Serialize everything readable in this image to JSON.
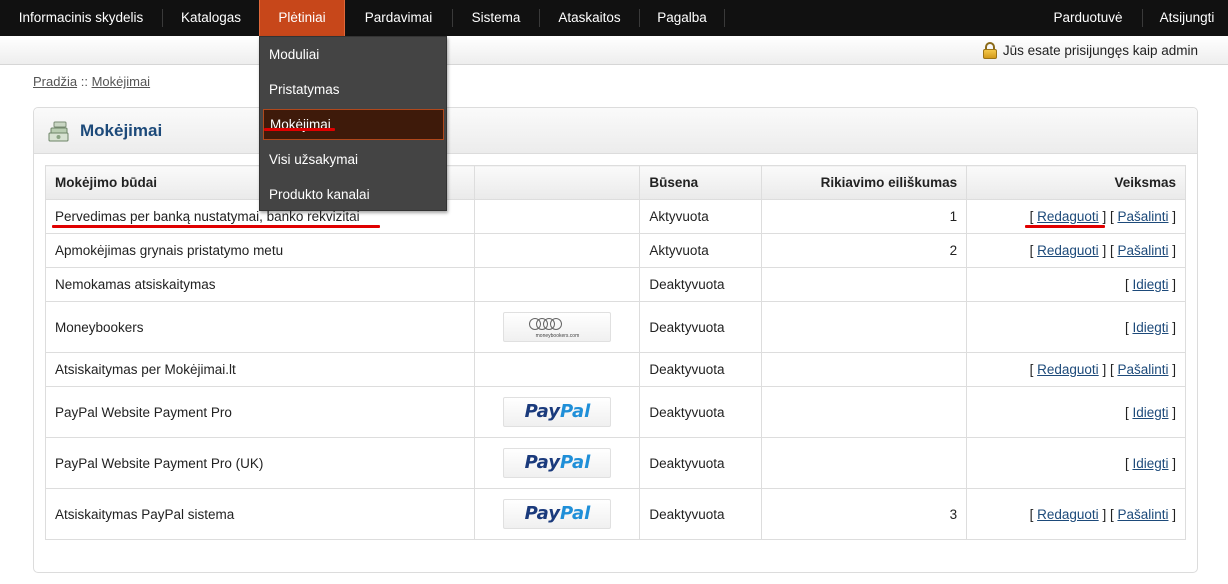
{
  "nav": {
    "items": [
      {
        "label": "Informacinis skydelis"
      },
      {
        "label": "Katalogas"
      },
      {
        "label": "Plėtiniai"
      },
      {
        "label": "Pardavimai"
      },
      {
        "label": "Sistema"
      },
      {
        "label": "Ataskaitos"
      },
      {
        "label": "Pagalba"
      }
    ],
    "right": [
      {
        "label": "Parduotuvė"
      },
      {
        "label": "Atsijungti"
      }
    ]
  },
  "subbar": {
    "login_text": "Jūs esate prisijungęs kaip admin",
    "icon": "lock-icon"
  },
  "dropdown": {
    "items": [
      {
        "label": "Moduliai"
      },
      {
        "label": "Pristatymas"
      },
      {
        "label": "Mokėjimai"
      },
      {
        "label": "Visi užsakymai"
      },
      {
        "label": "Produkto kanalai"
      }
    ]
  },
  "breadcrumb": {
    "home": "Pradžia",
    "separator": "::",
    "current": "Mokėjimai"
  },
  "panel": {
    "title": "Mokėjimai",
    "icon": "money-icon"
  },
  "table": {
    "headers": {
      "method": "Mokėjimo būdai",
      "logo": "",
      "status": "Būsena",
      "order": "Rikiavimo eiliškumas",
      "action": "Veiksmas"
    },
    "rows": [
      {
        "name": "Pervedimas per banką nustatymai, banko rekvizitai",
        "status": "Aktyvuota",
        "order": "1",
        "edit": "Redaguoti",
        "remove": "Pašalinti"
      },
      {
        "name": "Apmokėjimas grynais pristatymo metu",
        "status": "Aktyvuota",
        "order": "2",
        "edit": "Redaguoti",
        "remove": "Pašalinti"
      },
      {
        "name": "Nemokamas atsiskaitymas",
        "status": "Deaktyvuota",
        "order": "",
        "install": "Idiegti"
      },
      {
        "name": "Moneybookers",
        "status": "Deaktyvuota",
        "order": "",
        "install": "Idiegti",
        "logo": "moneybookers-logo",
        "logo_text": "moneybookers.com"
      },
      {
        "name": "Atsiskaitymas per Mokėjimai.lt",
        "status": "Deaktyvuota",
        "order": "",
        "edit": "Redaguoti",
        "remove": "Pašalinti"
      },
      {
        "name": "PayPal Website Payment Pro",
        "status": "Deaktyvuota",
        "order": "",
        "install": "Idiegti",
        "logo": "paypal-logo"
      },
      {
        "name": "PayPal Website Payment Pro (UK)",
        "status": "Deaktyvuota",
        "order": "",
        "install": "Idiegti",
        "logo": "paypal-logo"
      },
      {
        "name": "Atsiskaitymas PayPal sistema",
        "status": "Deaktyvuota",
        "order": "3",
        "edit": "Redaguoti",
        "remove": "Pašalinti",
        "logo": "paypal-logo"
      }
    ],
    "paypal": {
      "part1": "Pay",
      "part2": "Pal"
    }
  },
  "colors": {
    "nav_bg": "#111111",
    "nav_active": "#c7471a",
    "link": "#1d4a7a",
    "annotation": "#e00000"
  }
}
